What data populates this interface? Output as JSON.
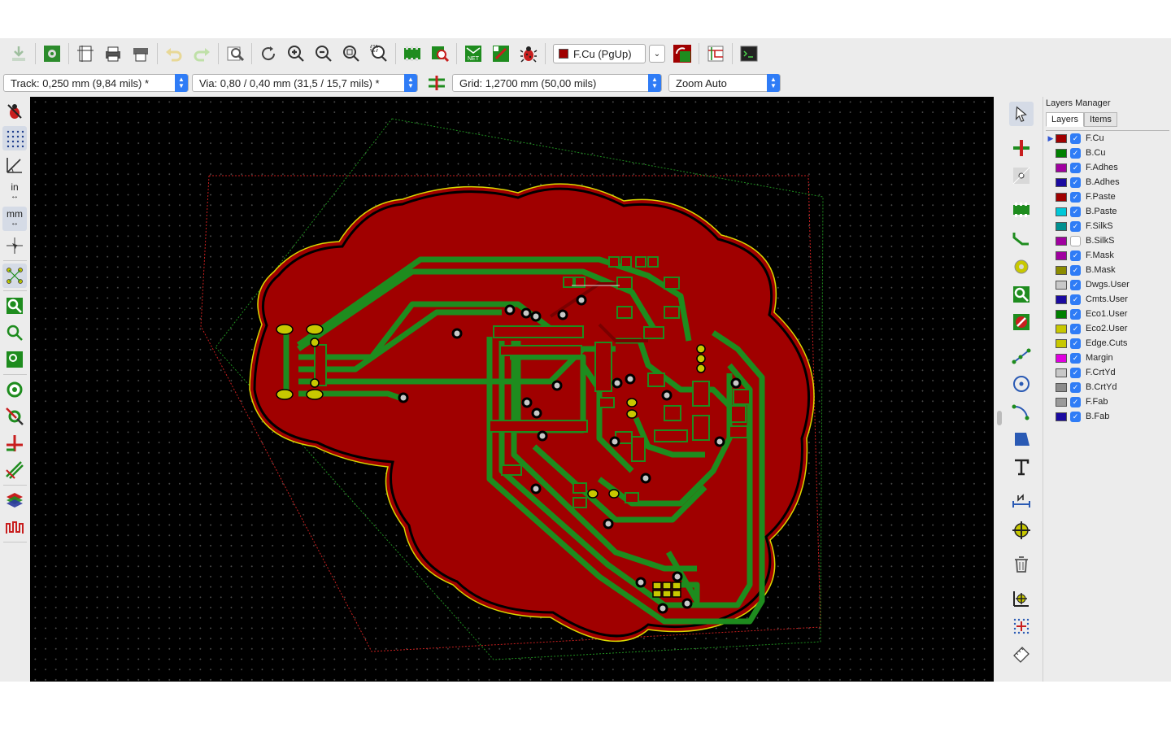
{
  "toolbar": {
    "layer_selector": {
      "label": "F.Cu (PgUp)",
      "color": "#a00000"
    },
    "icons": [
      "save-board-icon",
      "board-setup-icon",
      "page-settings-icon",
      "print-icon",
      "plot-icon",
      "undo-icon",
      "redo-icon",
      "find-icon",
      "refresh-icon",
      "zoom-in-icon",
      "zoom-out-icon",
      "zoom-fit-icon",
      "zoom-selection-icon",
      "footprint-editor-icon",
      "footprint-browser-icon",
      "netlist-icon",
      "update-pcb-icon",
      "drc-icon",
      "layer-pair-icon",
      "schematic-icon",
      "scripting-console-icon"
    ]
  },
  "options": {
    "track": "Track: 0,250 mm (9,84 mils) *",
    "via": "Via: 0,80 / 0,40 mm (31,5 / 15,7 mils) *",
    "grid": "Grid: 1,2700 mm (50,00 mils)",
    "zoom": "Zoom Auto",
    "units_in": "in",
    "units_mm": "mm"
  },
  "left_tools": [
    "drc-off-icon",
    "grid-toggle-icon",
    "polar-coords-icon",
    "inch-units-icon",
    "mm-units-icon",
    "cursor-shape-icon",
    "ratsnest-icon",
    "filled-zone-icon",
    "zone-outline-icon",
    "zone-sketch-icon",
    "pad-sketch-icon",
    "via-sketch-icon",
    "track-sketch-icon",
    "high-contrast-icon",
    "layers-manager-icon",
    "microwave-icon"
  ],
  "right_tools": [
    "select-icon",
    "highlight-net-icon",
    "local-ratsnest-icon",
    "add-footprint-icon",
    "route-track-icon",
    "add-via-icon",
    "add-zone-icon",
    "add-keepout-icon",
    "add-line-icon",
    "add-circle-icon",
    "add-arc-icon",
    "add-polygon-icon",
    "add-text-icon",
    "add-dimension-icon",
    "add-target-icon",
    "delete-icon",
    "set-origin-icon",
    "grid-origin-icon",
    "measure-icon"
  ],
  "layers_manager": {
    "title": "Layers Manager",
    "tabs": [
      "Layers",
      "Items"
    ],
    "layers": [
      {
        "name": "F.Cu",
        "color": "#a00000",
        "checked": true,
        "active": true
      },
      {
        "name": "B.Cu",
        "color": "#008000",
        "checked": true
      },
      {
        "name": "F.Adhes",
        "color": "#a000a0",
        "checked": true
      },
      {
        "name": "B.Adhes",
        "color": "#1a0aa0",
        "checked": true
      },
      {
        "name": "F.Paste",
        "color": "#a00000",
        "checked": true
      },
      {
        "name": "B.Paste",
        "color": "#00c8d8",
        "checked": true
      },
      {
        "name": "F.SilkS",
        "color": "#009090",
        "checked": true
      },
      {
        "name": "B.SilkS",
        "color": "#a000a0",
        "checked": false
      },
      {
        "name": "F.Mask",
        "color": "#a000a0",
        "checked": true
      },
      {
        "name": "B.Mask",
        "color": "#8c8c00",
        "checked": true
      },
      {
        "name": "Dwgs.User",
        "color": "#c8c8c8",
        "checked": true
      },
      {
        "name": "Cmts.User",
        "color": "#1a0aa0",
        "checked": true
      },
      {
        "name": "Eco1.User",
        "color": "#008000",
        "checked": true
      },
      {
        "name": "Eco2.User",
        "color": "#c8c800",
        "checked": true
      },
      {
        "name": "Edge.Cuts",
        "color": "#c8c800",
        "checked": true
      },
      {
        "name": "Margin",
        "color": "#e000e0",
        "checked": true
      },
      {
        "name": "F.CrtYd",
        "color": "#c8c8c8",
        "checked": true
      },
      {
        "name": "B.CrtYd",
        "color": "#8c8c8c",
        "checked": true
      },
      {
        "name": "F.Fab",
        "color": "#9a9a9a",
        "checked": true
      },
      {
        "name": "B.Fab",
        "color": "#1a0aa0",
        "checked": true
      }
    ]
  },
  "colors": {
    "copper_front": "#a00000",
    "copper_back": "#1e8c1e",
    "edge_cuts": "#d8d800",
    "courtyard_front": "#c81e1e",
    "courtyard_back": "#1e8c1e"
  }
}
